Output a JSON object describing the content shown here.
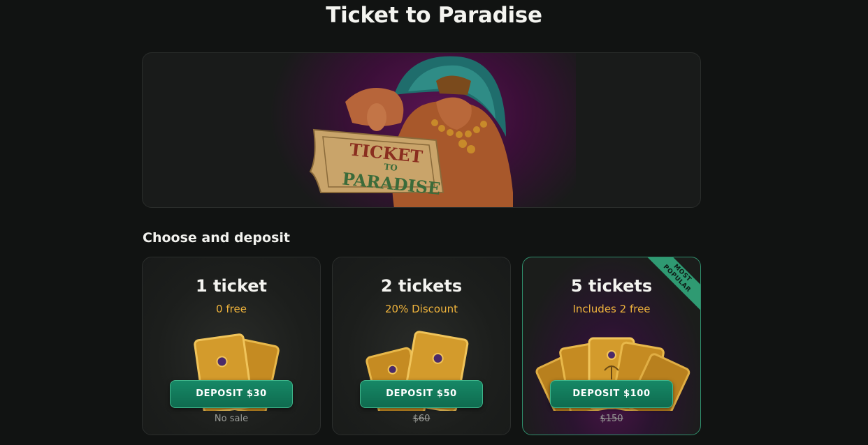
{
  "page": {
    "title": "Ticket to Paradise"
  },
  "hero": {
    "ticket_line1": "TICKET",
    "ticket_line2": "TO",
    "ticket_line3": "PARADISE"
  },
  "section": {
    "title": "Choose and deposit"
  },
  "cards": [
    {
      "title": "1 ticket",
      "subtitle": "0 free",
      "button": "DEPOSIT $30",
      "note": "No sale",
      "ticket_count": 2
    },
    {
      "title": "2 tickets",
      "subtitle": "20% Discount",
      "button": "DEPOSIT $50",
      "note": "$60",
      "ticket_count": 3
    },
    {
      "title": "5 tickets",
      "subtitle": "Includes 2 free",
      "button": "DEPOSIT $100",
      "note": "$150",
      "ticket_count": 5,
      "badge_line1": "MOST",
      "badge_line2": "POPULAR"
    }
  ],
  "colors": {
    "accent": "#168866",
    "highlight": "#f0b43c",
    "hero_purple": "#5a1452"
  },
  "icons": {
    "ticket": "golden-ticket-icon"
  }
}
